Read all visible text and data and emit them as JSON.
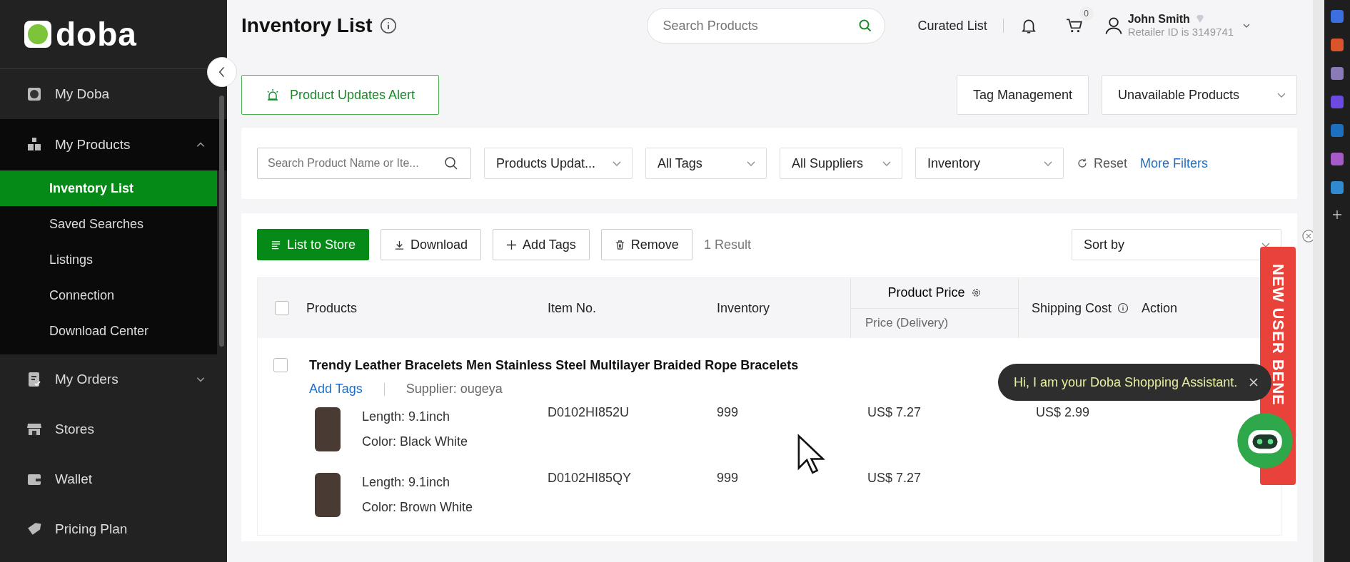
{
  "sidebar": {
    "logo": "doba",
    "items": [
      {
        "label": "My Doba"
      },
      {
        "label": "My Products",
        "expanded": true,
        "children": [
          {
            "label": "Inventory List",
            "selected": true
          },
          {
            "label": "Saved Searches",
            "selected": false
          },
          {
            "label": "Listings",
            "selected": false
          },
          {
            "label": "Connection",
            "selected": false
          },
          {
            "label": "Download Center",
            "selected": false
          }
        ]
      },
      {
        "label": "My Orders",
        "expanded": false
      },
      {
        "label": "Stores"
      },
      {
        "label": "Wallet"
      },
      {
        "label": "Pricing Plan"
      }
    ]
  },
  "header": {
    "title": "Inventory List",
    "search": {
      "placeholder": "Search Products"
    },
    "curated": "Curated List",
    "cart_count": "0",
    "user": {
      "name": "John Smith",
      "id_text": "Retailer ID is 3149741"
    }
  },
  "actions": {
    "alert": "Product Updates Alert",
    "tag_management": "Tag Management",
    "unavailable": "Unavailable Products"
  },
  "filters": {
    "search": {
      "placeholder": "Search Product Name or Ite..."
    },
    "dropdowns": [
      "Products Updat...",
      "All Tags",
      "All Suppliers",
      "Inventory"
    ],
    "reset": "Reset",
    "more": "More Filters"
  },
  "toolbar": {
    "buttons": [
      {
        "label": "List to Store",
        "kind": "primary"
      },
      {
        "label": "Download",
        "kind": "download"
      },
      {
        "label": "Add Tags",
        "kind": "add"
      },
      {
        "label": "Remove",
        "kind": "remove"
      }
    ],
    "result": "1 Result",
    "sort": "Sort by"
  },
  "table": {
    "select_all_checked": false,
    "columns": {
      "products": "Products",
      "item_no": "Item No.",
      "inventory": "Inventory",
      "price": "Product Price",
      "price_sub": "Price (Delivery)",
      "shipping": "Shipping Cost",
      "action": "Action"
    },
    "rows": [
      {
        "checked": false,
        "title": "Trendy Leather Bracelets Men Stainless Steel Multilayer Braided Rope Bracelets",
        "add_tags": "Add Tags",
        "supplier": "Supplier: ougeya",
        "variants": [
          {
            "length": "Length: 9.1inch",
            "color_option": "Color: Black White",
            "item_no": "D0102HI852U",
            "inventory": "999",
            "price": "US$ 7.27",
            "shipping": "US$ 2.99"
          },
          {
            "length": "Length: 9.1inch",
            "color_option": "Color: Brown White",
            "item_no": "D0102HI85QY",
            "inventory": "999",
            "price": "US$ 7.27"
          }
        ]
      }
    ]
  },
  "assistant": {
    "message": "Hi, I am your Doba Shopping Assistant."
  },
  "promo": {
    "label": "NEW USER BENE"
  }
}
